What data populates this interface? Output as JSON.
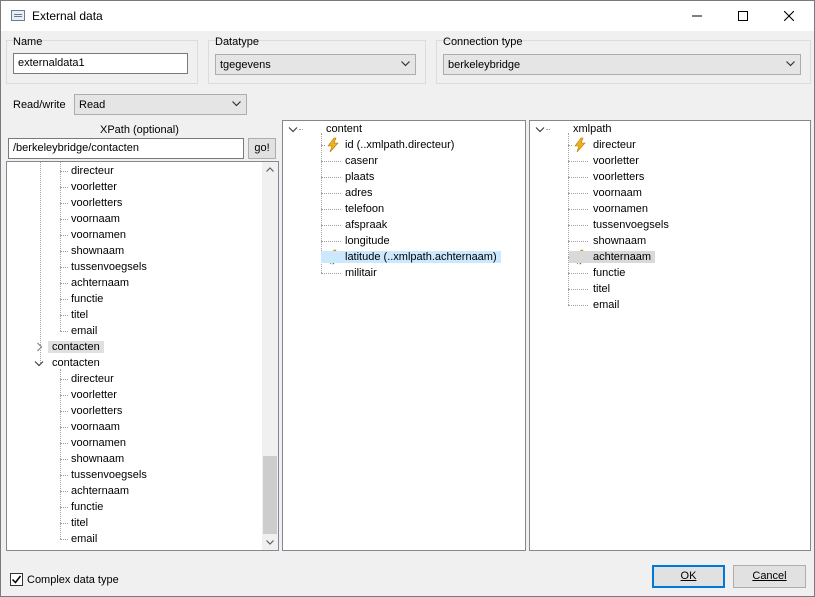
{
  "window": {
    "title": "External data"
  },
  "name_group": {
    "label": "Name",
    "value": "externaldata1"
  },
  "datatype_group": {
    "label": "Datatype",
    "value": "tgegevens"
  },
  "connection_group": {
    "label": "Connection type",
    "value": "berkeleybridge"
  },
  "readwrite": {
    "label": "Read/write",
    "value": "Read"
  },
  "xpath": {
    "label": "XPath (optional)",
    "value": "/berkeleybridge/contacten",
    "go_label": "go!"
  },
  "left_tree": {
    "top_items": [
      "directeur",
      "voorletter",
      "voorletters",
      "voornaam",
      "voornamen",
      "shownaam",
      "tussenvoegsels",
      "achternaam",
      "functie",
      "titel",
      "email"
    ],
    "collapsed_node": "contacten",
    "expanded_node": "contacten",
    "bottom_items": [
      "directeur",
      "voorletter",
      "voorletters",
      "voornaam",
      "voornamen",
      "shownaam",
      "tussenvoegsels",
      "achternaam",
      "functie",
      "titel",
      "email"
    ]
  },
  "middle_tree": {
    "root": "content",
    "items": [
      {
        "label": "id (..xmlpath.directeur)",
        "icon": "lightning-icon",
        "state": ""
      },
      {
        "label": "casenr",
        "icon": "",
        "state": ""
      },
      {
        "label": "plaats",
        "icon": "",
        "state": ""
      },
      {
        "label": "adres",
        "icon": "",
        "state": ""
      },
      {
        "label": "telefoon",
        "icon": "",
        "state": ""
      },
      {
        "label": "afspraak",
        "icon": "",
        "state": ""
      },
      {
        "label": "longitude",
        "icon": "",
        "state": ""
      },
      {
        "label": "latitude (..xmlpath.achternaam)",
        "icon": "arrow-lightning-icon",
        "state": "selected"
      },
      {
        "label": "militair",
        "icon": "",
        "state": ""
      }
    ]
  },
  "right_tree": {
    "root": "xmlpath",
    "items": [
      {
        "label": "directeur",
        "icon": "lightning-icon",
        "state": ""
      },
      {
        "label": "voorletter",
        "icon": "",
        "state": ""
      },
      {
        "label": "voorletters",
        "icon": "",
        "state": ""
      },
      {
        "label": "voornaam",
        "icon": "",
        "state": ""
      },
      {
        "label": "voornamen",
        "icon": "",
        "state": ""
      },
      {
        "label": "tussenvoegsels",
        "icon": "",
        "state": ""
      },
      {
        "label": "shownaam",
        "icon": "",
        "state": ""
      },
      {
        "label": "achternaam",
        "icon": "arrow-lightning-icon",
        "state": "selected"
      },
      {
        "label": "functie",
        "icon": "",
        "state": ""
      },
      {
        "label": "titel",
        "icon": "",
        "state": ""
      },
      {
        "label": "email",
        "icon": "",
        "state": ""
      }
    ]
  },
  "complex": {
    "label": "Complex data type",
    "checked": true
  },
  "buttons": {
    "ok": "OK",
    "cancel": "Cancel"
  },
  "colors": {
    "accent": "#0078d7",
    "selection_blue": "#cce8ff",
    "lightning": "#f2b21b"
  }
}
